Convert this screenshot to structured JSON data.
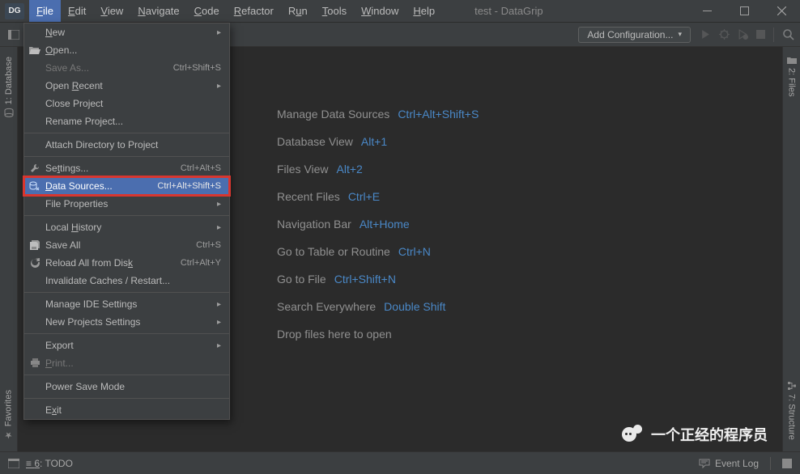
{
  "app": {
    "logo": "DG",
    "title": "test - DataGrip"
  },
  "menubar": [
    "File",
    "Edit",
    "View",
    "Navigate",
    "Code",
    "Refactor",
    "Run",
    "Tools",
    "Window",
    "Help"
  ],
  "toolbar": {
    "add_config": "Add Configuration..."
  },
  "left_tabs": {
    "database": "1: Database",
    "favorites": "Favorites"
  },
  "right_tabs": {
    "files": "2: Files",
    "structure": "7: Structure"
  },
  "welcome": [
    {
      "label": "Manage Data Sources",
      "shortcut": "Ctrl+Alt+Shift+S"
    },
    {
      "label": "Database View",
      "shortcut": "Alt+1"
    },
    {
      "label": "Files View",
      "shortcut": "Alt+2"
    },
    {
      "label": "Recent Files",
      "shortcut": "Ctrl+E"
    },
    {
      "label": "Navigation Bar",
      "shortcut": "Alt+Home"
    },
    {
      "label": "Go to Table or Routine",
      "shortcut": "Ctrl+N"
    },
    {
      "label": "Go to File",
      "shortcut": "Ctrl+Shift+N"
    },
    {
      "label": "Search Everywhere",
      "shortcut": "Double Shift"
    },
    {
      "label": "Drop files here to open",
      "shortcut": ""
    }
  ],
  "file_menu": {
    "new": "New",
    "open": "Open...",
    "save_as": "Save As...",
    "save_as_sc": "Ctrl+Shift+S",
    "open_recent": "Open Recent",
    "close_project": "Close Project",
    "rename_project": "Rename Project...",
    "attach_dir": "Attach Directory to Project",
    "settings": "Settings...",
    "settings_sc": "Ctrl+Alt+S",
    "data_sources": "Data Sources...",
    "data_sources_sc": "Ctrl+Alt+Shift+S",
    "file_properties": "File Properties",
    "local_history": "Local History",
    "save_all": "Save All",
    "save_all_sc": "Ctrl+S",
    "reload": "Reload All from Disk",
    "reload_sc": "Ctrl+Alt+Y",
    "invalidate": "Invalidate Caches / Restart...",
    "manage_ide": "Manage IDE Settings",
    "new_proj_settings": "New Projects Settings",
    "export": "Export",
    "print": "Print...",
    "power_save": "Power Save Mode",
    "exit": "Exit"
  },
  "statusbar": {
    "todo": "6: TODO",
    "event_log": "Event Log"
  },
  "watermark": "一个正经的程序员"
}
